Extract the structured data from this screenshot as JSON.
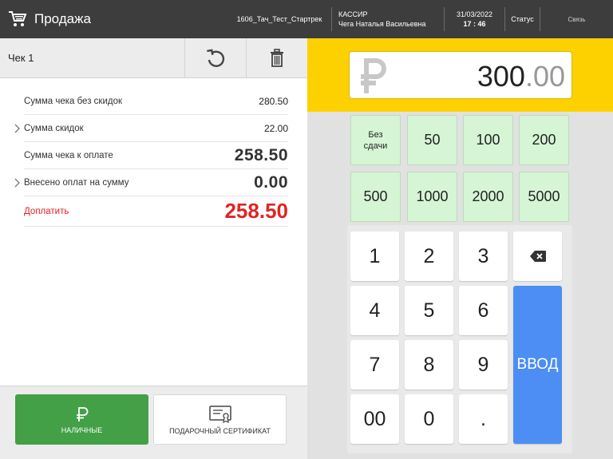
{
  "header": {
    "title": "Продажа",
    "store": "1606_Тач_Тест_Стартрек",
    "cashier_role": "КАССИР",
    "cashier_name": "Чега Наталья Васильевна",
    "date": "31/03/2022",
    "time": "17 : 46",
    "status_label": "Статус",
    "connection_label": "Связь"
  },
  "receipt": {
    "name": "Чек 1",
    "rows": [
      {
        "label": "Сумма чека без скидок",
        "value": "280.50"
      },
      {
        "label": "Сумма скидок",
        "value": "22.00"
      },
      {
        "label": "Сумма чека к оплате",
        "value": "258.50"
      },
      {
        "label": "Внесено оплат на сумму",
        "value": "0.00"
      },
      {
        "label": "Доплатить",
        "value": "258.50"
      }
    ]
  },
  "payment": {
    "cash_label": "НАЛИЧНЫЕ",
    "certificate_label": "ПОДАРОЧНЫЙ СЕРТИФИКАТ"
  },
  "amount": {
    "integer": "300",
    "decimal": ".00"
  },
  "quick": [
    "Без\nсдачи",
    "50",
    "100",
    "200",
    "500",
    "1000",
    "2000",
    "5000"
  ],
  "keys": [
    "1",
    "2",
    "3",
    "4",
    "5",
    "6",
    "7",
    "8",
    "9",
    "00",
    "0",
    "."
  ],
  "enter_label": "ВВОД",
  "colors": {
    "header": "#3d3d3d",
    "accent_yellow": "#fdd100",
    "cash_green": "#43a047",
    "enter_blue": "#4c8ef4",
    "due_red": "#e02424",
    "quick_green": "#d5f5d5"
  }
}
